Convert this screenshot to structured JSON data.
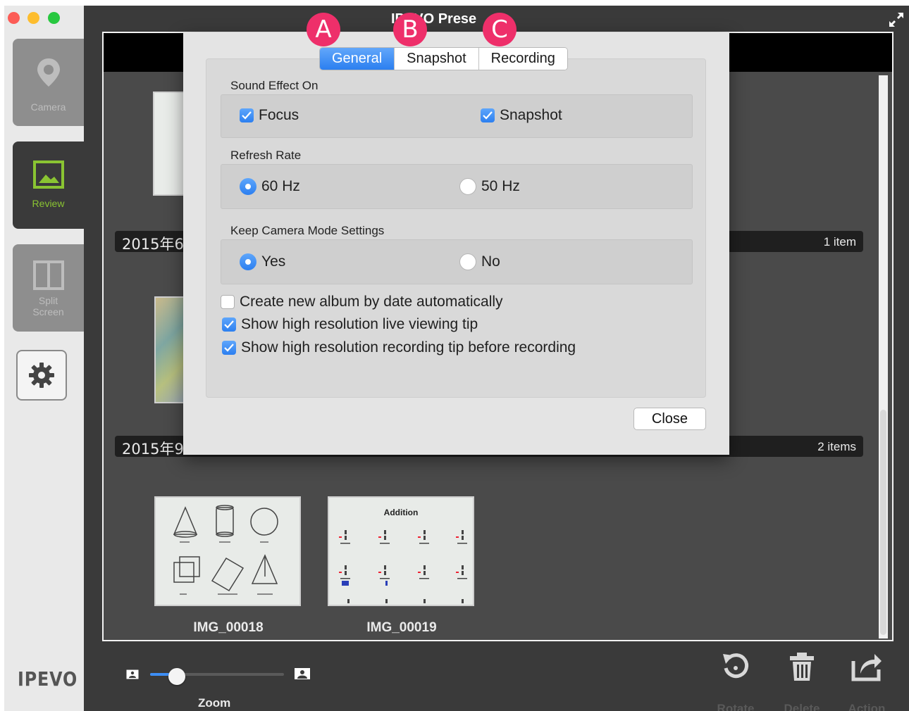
{
  "window": {
    "title": "IPEVO Prese",
    "title_overlap_note_visible": "IPEVO Presenter"
  },
  "sidebar": {
    "camera_label": "Camera",
    "review_label": "Review",
    "split_label_1": "Split",
    "split_label_2": "Screen",
    "brand": "IPEVO",
    "review_color": "#8ac432"
  },
  "content": {
    "groups": [
      {
        "date": "2015年6",
        "count": "1 item"
      },
      {
        "date": "2015年9",
        "count": "2 items"
      }
    ],
    "thumbnails": [
      {
        "name": "IMG_00018"
      },
      {
        "name": "IMG_00019",
        "heading": "Addition"
      }
    ]
  },
  "bottombar": {
    "zoom_label": "Zoom",
    "zoom_level": 0.2,
    "tools": [
      {
        "label": "Rotate",
        "icon": "rotate-icon"
      },
      {
        "label": "Delete",
        "icon": "trash-icon"
      },
      {
        "label": "Action",
        "icon": "share-icon"
      }
    ]
  },
  "dialog": {
    "tabs": [
      "General",
      "Snapshot",
      "Recording"
    ],
    "active_tab": "General",
    "sound_effect": {
      "title": "Sound Effect On",
      "focus": "Focus",
      "snapshot": "Snapshot"
    },
    "refresh_rate": {
      "title": "Refresh Rate",
      "opt1": "60 Hz",
      "opt2": "50 Hz"
    },
    "keep_camera": {
      "title": "Keep Camera Mode Settings",
      "opt1": "Yes",
      "opt2": "No"
    },
    "checks": [
      {
        "label": "Create new album by date automatically",
        "checked": false
      },
      {
        "label": "Show high resolution live viewing tip",
        "checked": true
      },
      {
        "label": "Show high resolution recording tip before recording",
        "checked": true
      }
    ],
    "close_label": "Close"
  },
  "badges": [
    "A",
    "B",
    "C"
  ],
  "colors": {
    "accent": "#2c7ff0",
    "badge": "#ee2f6a"
  }
}
